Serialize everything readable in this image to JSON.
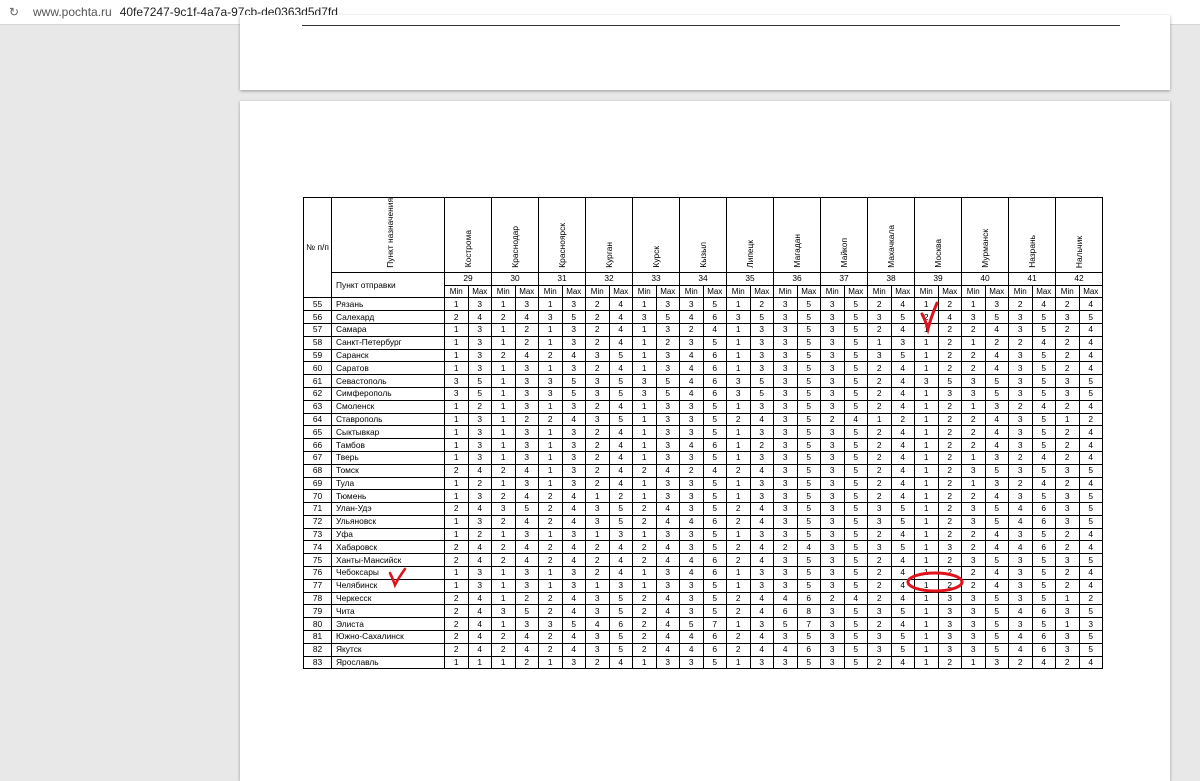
{
  "browser": {
    "host": "www.pochta.ru",
    "path": "40fe7247-9c1f-4a7a-97cb-de0363d5d7fd"
  },
  "table": {
    "num_header": "№ п/п",
    "dest_header": "Пункт назначения",
    "origin_header": "Пункт отправки",
    "min_label": "Min",
    "max_label": "Max",
    "destinations": [
      {
        "name": "Кострома",
        "code": "29"
      },
      {
        "name": "Краснодар",
        "code": "30"
      },
      {
        "name": "Красноярск",
        "code": "31"
      },
      {
        "name": "Курган",
        "code": "32"
      },
      {
        "name": "Курск",
        "code": "33"
      },
      {
        "name": "Кызыл",
        "code": "34"
      },
      {
        "name": "Липецк",
        "code": "35"
      },
      {
        "name": "Магадан",
        "code": "36"
      },
      {
        "name": "Майкоп",
        "code": "37"
      },
      {
        "name": "Махачкала",
        "code": "38"
      },
      {
        "name": "Москва",
        "code": "39"
      },
      {
        "name": "Мурманск",
        "code": "40"
      },
      {
        "name": "Назрань",
        "code": "41"
      },
      {
        "name": "Нальчик",
        "code": "42"
      }
    ],
    "rows": [
      {
        "n": "55",
        "city": "Рязань",
        "v": [
          "1",
          "3",
          "1",
          "3",
          "1",
          "3",
          "2",
          "4",
          "1",
          "3",
          "3",
          "5",
          "1",
          "2",
          "3",
          "5",
          "3",
          "5",
          "2",
          "4",
          "1",
          "2",
          "1",
          "3",
          "2",
          "4",
          "2",
          "4"
        ]
      },
      {
        "n": "56",
        "city": "Салехард",
        "v": [
          "2",
          "4",
          "2",
          "4",
          "3",
          "5",
          "2",
          "4",
          "3",
          "5",
          "4",
          "6",
          "3",
          "5",
          "3",
          "5",
          "3",
          "5",
          "3",
          "5",
          "2",
          "4",
          "3",
          "5",
          "3",
          "5",
          "3",
          "5"
        ]
      },
      {
        "n": "57",
        "city": "Самара",
        "v": [
          "1",
          "3",
          "1",
          "2",
          "1",
          "3",
          "2",
          "4",
          "1",
          "3",
          "2",
          "4",
          "1",
          "3",
          "3",
          "5",
          "3",
          "5",
          "2",
          "4",
          "1",
          "2",
          "2",
          "4",
          "3",
          "5",
          "2",
          "4"
        ]
      },
      {
        "n": "58",
        "city": "Санкт-Петербург",
        "v": [
          "1",
          "3",
          "1",
          "2",
          "1",
          "3",
          "2",
          "4",
          "1",
          "2",
          "3",
          "5",
          "1",
          "3",
          "3",
          "5",
          "3",
          "5",
          "1",
          "3",
          "1",
          "2",
          "1",
          "2",
          "2",
          "4",
          "2",
          "4"
        ]
      },
      {
        "n": "59",
        "city": "Саранск",
        "v": [
          "1",
          "3",
          "2",
          "4",
          "2",
          "4",
          "3",
          "5",
          "1",
          "3",
          "4",
          "6",
          "1",
          "3",
          "3",
          "5",
          "3",
          "5",
          "3",
          "5",
          "1",
          "2",
          "2",
          "4",
          "3",
          "5",
          "2",
          "4"
        ]
      },
      {
        "n": "60",
        "city": "Саратов",
        "v": [
          "1",
          "3",
          "1",
          "3",
          "1",
          "3",
          "2",
          "4",
          "1",
          "3",
          "4",
          "6",
          "1",
          "3",
          "3",
          "5",
          "3",
          "5",
          "2",
          "4",
          "1",
          "2",
          "2",
          "4",
          "3",
          "5",
          "2",
          "4"
        ]
      },
      {
        "n": "61",
        "city": "Севастополь",
        "v": [
          "3",
          "5",
          "1",
          "3",
          "3",
          "5",
          "3",
          "5",
          "3",
          "5",
          "4",
          "6",
          "3",
          "5",
          "3",
          "5",
          "3",
          "5",
          "2",
          "4",
          "3",
          "5",
          "3",
          "5",
          "3",
          "5",
          "3",
          "5"
        ]
      },
      {
        "n": "62",
        "city": "Симферополь",
        "v": [
          "3",
          "5",
          "1",
          "3",
          "3",
          "5",
          "3",
          "5",
          "3",
          "5",
          "4",
          "6",
          "3",
          "5",
          "3",
          "5",
          "3",
          "5",
          "2",
          "4",
          "1",
          "3",
          "3",
          "5",
          "3",
          "5",
          "3",
          "5"
        ]
      },
      {
        "n": "63",
        "city": "Смоленск",
        "v": [
          "1",
          "2",
          "1",
          "3",
          "1",
          "3",
          "2",
          "4",
          "1",
          "3",
          "3",
          "5",
          "1",
          "3",
          "3",
          "5",
          "3",
          "5",
          "2",
          "4",
          "1",
          "2",
          "1",
          "3",
          "2",
          "4",
          "2",
          "4"
        ]
      },
      {
        "n": "64",
        "city": "Ставрополь",
        "v": [
          "1",
          "3",
          "1",
          "2",
          "2",
          "4",
          "3",
          "5",
          "1",
          "3",
          "3",
          "5",
          "2",
          "4",
          "3",
          "5",
          "2",
          "4",
          "1",
          "2",
          "1",
          "2",
          "2",
          "4",
          "3",
          "5",
          "1",
          "2"
        ]
      },
      {
        "n": "65",
        "city": "Сыктывкар",
        "v": [
          "1",
          "3",
          "1",
          "3",
          "1",
          "3",
          "2",
          "4",
          "1",
          "3",
          "3",
          "5",
          "1",
          "3",
          "3",
          "5",
          "3",
          "5",
          "2",
          "4",
          "1",
          "2",
          "2",
          "4",
          "3",
          "5",
          "2",
          "4"
        ]
      },
      {
        "n": "66",
        "city": "Тамбов",
        "v": [
          "1",
          "3",
          "1",
          "3",
          "1",
          "3",
          "2",
          "4",
          "1",
          "3",
          "4",
          "6",
          "1",
          "2",
          "3",
          "5",
          "3",
          "5",
          "2",
          "4",
          "1",
          "2",
          "2",
          "4",
          "3",
          "5",
          "2",
          "4"
        ]
      },
      {
        "n": "67",
        "city": "Тверь",
        "v": [
          "1",
          "3",
          "1",
          "3",
          "1",
          "3",
          "2",
          "4",
          "1",
          "3",
          "3",
          "5",
          "1",
          "3",
          "3",
          "5",
          "3",
          "5",
          "2",
          "4",
          "1",
          "2",
          "1",
          "3",
          "2",
          "4",
          "2",
          "4"
        ]
      },
      {
        "n": "68",
        "city": "Томск",
        "v": [
          "2",
          "4",
          "2",
          "4",
          "1",
          "3",
          "2",
          "4",
          "2",
          "4",
          "2",
          "4",
          "2",
          "4",
          "3",
          "5",
          "3",
          "5",
          "2",
          "4",
          "1",
          "2",
          "3",
          "5",
          "3",
          "5",
          "3",
          "5"
        ]
      },
      {
        "n": "69",
        "city": "Тула",
        "v": [
          "1",
          "2",
          "1",
          "3",
          "1",
          "3",
          "2",
          "4",
          "1",
          "3",
          "3",
          "5",
          "1",
          "3",
          "3",
          "5",
          "3",
          "5",
          "2",
          "4",
          "1",
          "2",
          "1",
          "3",
          "2",
          "4",
          "2",
          "4"
        ]
      },
      {
        "n": "70",
        "city": "Тюмень",
        "v": [
          "1",
          "3",
          "2",
          "4",
          "2",
          "4",
          "1",
          "2",
          "1",
          "3",
          "3",
          "5",
          "1",
          "3",
          "3",
          "5",
          "3",
          "5",
          "2",
          "4",
          "1",
          "2",
          "2",
          "4",
          "3",
          "5",
          "3",
          "5"
        ]
      },
      {
        "n": "71",
        "city": "Улан-Удэ",
        "v": [
          "2",
          "4",
          "3",
          "5",
          "2",
          "4",
          "3",
          "5",
          "2",
          "4",
          "3",
          "5",
          "2",
          "4",
          "3",
          "5",
          "3",
          "5",
          "3",
          "5",
          "1",
          "2",
          "3",
          "5",
          "4",
          "6",
          "3",
          "5"
        ]
      },
      {
        "n": "72",
        "city": "Ульяновск",
        "v": [
          "1",
          "3",
          "2",
          "4",
          "2",
          "4",
          "3",
          "5",
          "2",
          "4",
          "4",
          "6",
          "2",
          "4",
          "3",
          "5",
          "3",
          "5",
          "3",
          "5",
          "1",
          "2",
          "3",
          "5",
          "4",
          "6",
          "3",
          "5"
        ]
      },
      {
        "n": "73",
        "city": "Уфа",
        "v": [
          "1",
          "2",
          "1",
          "3",
          "1",
          "3",
          "1",
          "3",
          "1",
          "3",
          "3",
          "5",
          "1",
          "3",
          "3",
          "5",
          "3",
          "5",
          "2",
          "4",
          "1",
          "2",
          "2",
          "4",
          "3",
          "5",
          "2",
          "4"
        ]
      },
      {
        "n": "74",
        "city": "Хабаровск",
        "v": [
          "2",
          "4",
          "2",
          "4",
          "2",
          "4",
          "2",
          "4",
          "2",
          "4",
          "3",
          "5",
          "2",
          "4",
          "2",
          "4",
          "3",
          "5",
          "3",
          "5",
          "1",
          "3",
          "2",
          "4",
          "4",
          "6",
          "2",
          "4"
        ]
      },
      {
        "n": "75",
        "city": "Ханты-Мансийск",
        "v": [
          "2",
          "4",
          "2",
          "4",
          "2",
          "4",
          "2",
          "4",
          "2",
          "4",
          "4",
          "6",
          "2",
          "4",
          "3",
          "5",
          "3",
          "5",
          "2",
          "4",
          "1",
          "2",
          "3",
          "5",
          "3",
          "5",
          "3",
          "5"
        ]
      },
      {
        "n": "76",
        "city": "Чебоксары",
        "v": [
          "1",
          "3",
          "1",
          "3",
          "1",
          "3",
          "2",
          "4",
          "1",
          "3",
          "4",
          "6",
          "1",
          "3",
          "3",
          "5",
          "3",
          "5",
          "2",
          "4",
          "1",
          "2",
          "2",
          "4",
          "3",
          "5",
          "2",
          "4"
        ]
      },
      {
        "n": "77",
        "city": "Челябинск",
        "v": [
          "1",
          "3",
          "1",
          "3",
          "1",
          "3",
          "1",
          "3",
          "1",
          "3",
          "3",
          "5",
          "1",
          "3",
          "3",
          "5",
          "3",
          "5",
          "2",
          "4",
          "1",
          "2",
          "2",
          "4",
          "3",
          "5",
          "2",
          "4"
        ]
      },
      {
        "n": "78",
        "city": "Черкесск",
        "v": [
          "2",
          "4",
          "1",
          "2",
          "2",
          "4",
          "3",
          "5",
          "2",
          "4",
          "3",
          "5",
          "2",
          "4",
          "4",
          "6",
          "2",
          "4",
          "2",
          "4",
          "1",
          "3",
          "3",
          "5",
          "3",
          "5",
          "1",
          "2"
        ]
      },
      {
        "n": "79",
        "city": "Чита",
        "v": [
          "2",
          "4",
          "3",
          "5",
          "2",
          "4",
          "3",
          "5",
          "2",
          "4",
          "3",
          "5",
          "2",
          "4",
          "6",
          "8",
          "3",
          "5",
          "3",
          "5",
          "1",
          "3",
          "3",
          "5",
          "4",
          "6",
          "3",
          "5"
        ]
      },
      {
        "n": "80",
        "city": "Элиста",
        "v": [
          "2",
          "4",
          "1",
          "3",
          "3",
          "5",
          "4",
          "6",
          "2",
          "4",
          "5",
          "7",
          "1",
          "3",
          "5",
          "7",
          "3",
          "5",
          "2",
          "4",
          "1",
          "3",
          "3",
          "5",
          "3",
          "5",
          "1",
          "3"
        ]
      },
      {
        "n": "81",
        "city": "Южно-Сахалинск",
        "v": [
          "2",
          "4",
          "2",
          "4",
          "2",
          "4",
          "3",
          "5",
          "2",
          "4",
          "4",
          "6",
          "2",
          "4",
          "3",
          "5",
          "3",
          "5",
          "3",
          "5",
          "1",
          "3",
          "3",
          "5",
          "4",
          "6",
          "3",
          "5"
        ]
      },
      {
        "n": "82",
        "city": "Якутск",
        "v": [
          "2",
          "4",
          "2",
          "4",
          "2",
          "4",
          "3",
          "5",
          "2",
          "4",
          "4",
          "6",
          "2",
          "4",
          "4",
          "6",
          "3",
          "5",
          "3",
          "5",
          "1",
          "3",
          "3",
          "5",
          "4",
          "6",
          "3",
          "5"
        ]
      },
      {
        "n": "83",
        "city": "Ярославль",
        "v": [
          "1",
          "1",
          "1",
          "2",
          "1",
          "3",
          "2",
          "4",
          "1",
          "3",
          "3",
          "5",
          "1",
          "3",
          "3",
          "5",
          "3",
          "5",
          "2",
          "4",
          "1",
          "2",
          "1",
          "3",
          "2",
          "4",
          "2",
          "4"
        ]
      }
    ]
  },
  "annotations": {
    "ink_color": "#e0121b"
  }
}
